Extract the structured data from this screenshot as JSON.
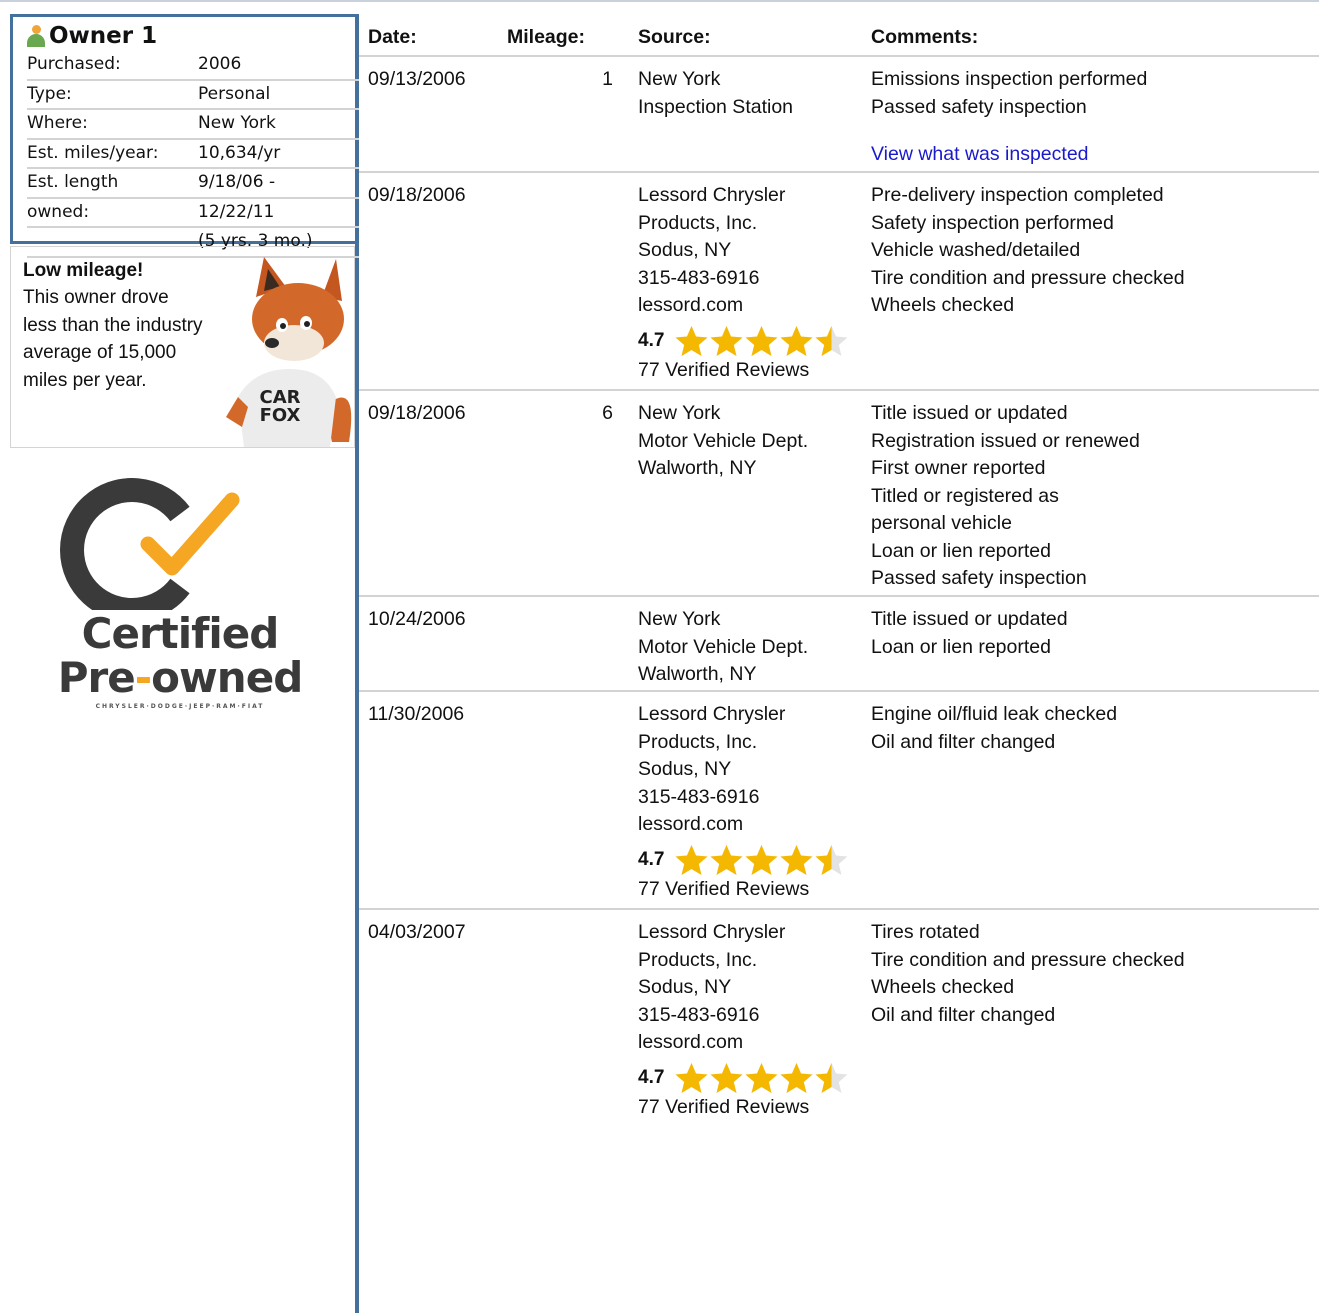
{
  "owner": {
    "title": "Owner 1",
    "info": [
      {
        "label": "Purchased:",
        "value": "2006"
      },
      {
        "label": "Type:",
        "value": "Personal"
      },
      {
        "label": "Where:",
        "value": "New York"
      },
      {
        "label": "Est. miles/year:",
        "value": "10,634/yr"
      },
      {
        "label": "Est. length",
        "value": "9/18/06 -"
      },
      {
        "label": "owned:",
        "value": "12/22/11"
      },
      {
        "label": "",
        "value": "(5 yrs. 3 mo.)"
      }
    ]
  },
  "mileage_note": {
    "title": "Low mileage!",
    "text": "This owner drove less than the industry average of 15,000 miles per year.",
    "mascot_text_1": "CAR",
    "mascot_text_2": "FOX"
  },
  "cpo_logo": {
    "line1": "Certified",
    "line2_a": "Pre",
    "line2_dash": "-",
    "line2_b": "owned",
    "brands": "CHRYSLER·DODGE·JEEP·RAM·FIAT"
  },
  "table": {
    "headers": {
      "date": "Date:",
      "mileage": "Mileage:",
      "source": "Source:",
      "comments": "Comments:"
    },
    "rows": [
      {
        "date": "09/13/2006",
        "mileage": "1",
        "source": [
          "New York",
          "Inspection Station"
        ],
        "comments": [
          "Emissions inspection performed",
          "Passed safety inspection"
        ],
        "link": "View what was inspected"
      },
      {
        "date": "09/18/2006",
        "mileage": "",
        "source": [
          "Lessord Chrysler",
          "Products, Inc.",
          "Sodus, NY",
          "315-483-6916",
          "lessord.com"
        ],
        "rating": "4.7",
        "reviews": "77 Verified Reviews",
        "comments": [
          "Pre-delivery inspection completed",
          "Safety inspection performed",
          "Vehicle washed/detailed",
          "Tire condition and pressure checked",
          "Wheels checked"
        ]
      },
      {
        "date": "09/18/2006",
        "mileage": "6",
        "source": [
          "New York",
          "Motor Vehicle Dept.",
          "Walworth, NY"
        ],
        "comments": [
          "Title issued or updated",
          "Registration issued or renewed",
          "First owner reported",
          "Titled or registered as",
          "personal vehicle",
          "Loan or lien reported",
          "Passed safety inspection"
        ]
      },
      {
        "date": "10/24/2006",
        "mileage": "",
        "source": [
          "New York",
          "Motor Vehicle Dept.",
          "Walworth, NY"
        ],
        "comments": [
          "Title issued or updated",
          "Loan or lien reported"
        ]
      },
      {
        "date": "11/30/2006",
        "mileage": "",
        "source": [
          "Lessord Chrysler",
          "Products, Inc.",
          "Sodus, NY",
          "315-483-6916",
          "lessord.com"
        ],
        "rating": "4.7",
        "reviews": "77 Verified Reviews",
        "comments": [
          "Engine oil/fluid leak checked",
          "Oil and filter changed"
        ]
      },
      {
        "date": "04/03/2007",
        "mileage": "",
        "source": [
          "Lessord Chrysler",
          "Products, Inc.",
          "Sodus, NY",
          "315-483-6916",
          "lessord.com"
        ],
        "rating": "4.7",
        "reviews": "77 Verified Reviews",
        "comments": [
          "Tires rotated",
          "Tire condition and pressure checked",
          "Wheels checked",
          "Oil and filter changed"
        ]
      }
    ]
  },
  "colors": {
    "accent_border": "#43709c",
    "link": "#1a1acc",
    "star": "#f5b800",
    "check": "#f5a623"
  }
}
